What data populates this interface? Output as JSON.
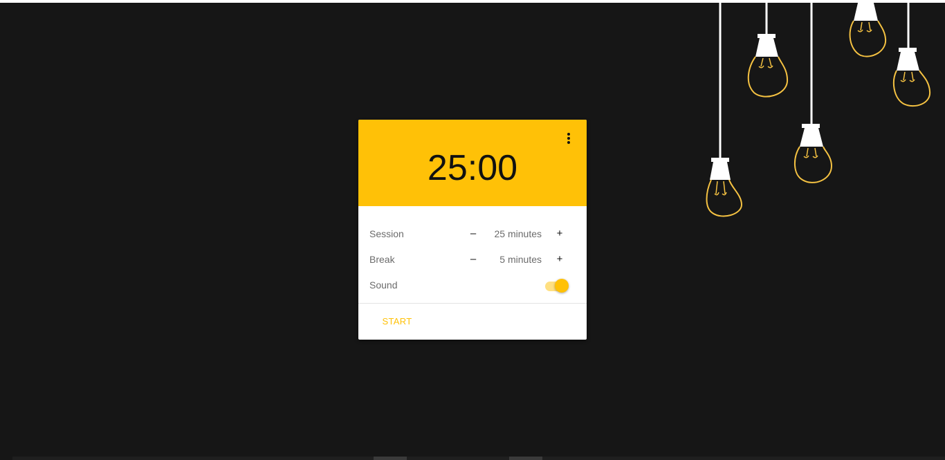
{
  "timer": {
    "display": "25:00",
    "menu_icon": "more-vert-icon"
  },
  "settings": {
    "session": {
      "label": "Session",
      "minus": "–",
      "value": "25 minutes",
      "plus": "+"
    },
    "break": {
      "label": "Break",
      "minus": "–",
      "value": "5 minutes",
      "plus": "+"
    },
    "sound": {
      "label": "Sound",
      "enabled": true
    }
  },
  "actions": {
    "start_label": "START"
  },
  "colors": {
    "accent": "#ffc107",
    "background": "#161616",
    "bulb_glow": "#f5c242"
  }
}
